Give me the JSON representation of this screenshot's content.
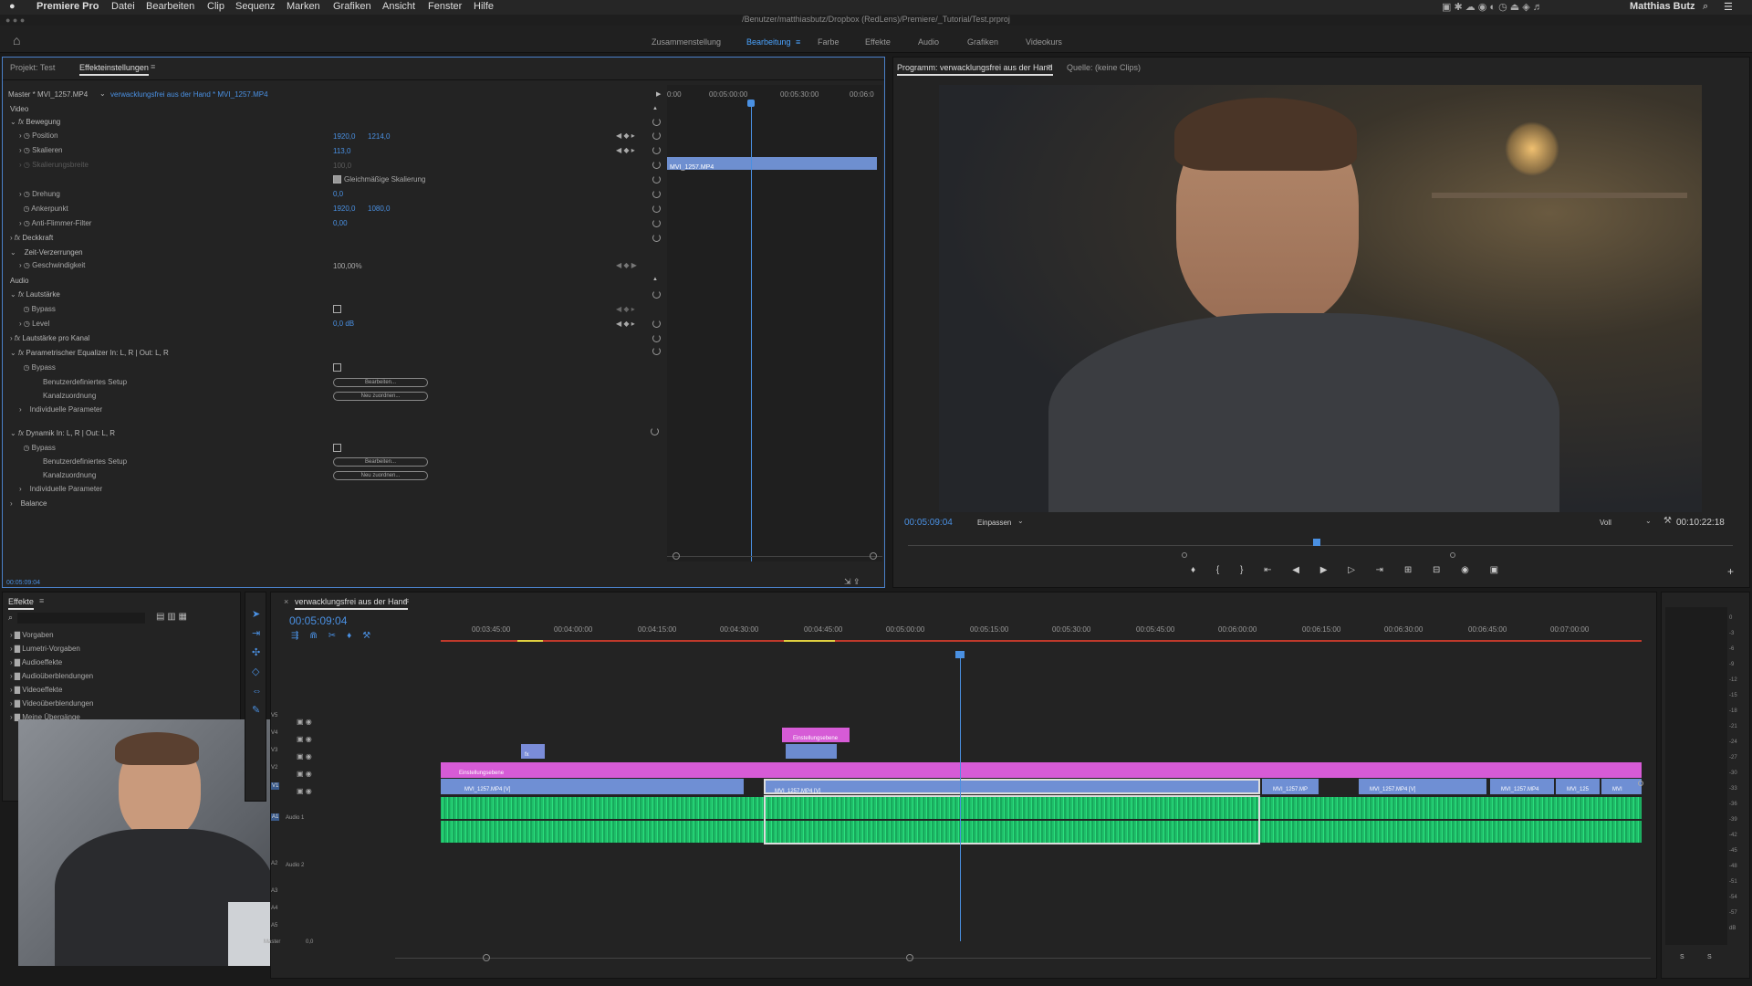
{
  "menubar": {
    "apple": "",
    "app": "Premiere Pro",
    "items": [
      "Datei",
      "Bearbeiten",
      "Clip",
      "Sequenz",
      "Marken",
      "Grafiken",
      "Ansicht",
      "Fenster",
      "Hilfe"
    ],
    "user": "Matthias Butz"
  },
  "title": "/Benutzer/matthiasbutz/Dropbox (RedLens)/Premiere/_Tutorial/Test.prproj",
  "workspaces": [
    "Zusammenstellung",
    "Bearbeitung",
    "Farbe",
    "Effekte",
    "Audio",
    "Grafiken",
    "Videokurs"
  ],
  "effect_controls": {
    "tab_project": "Projekt: Test",
    "tab_effects": "Effekteinstellungen",
    "master": "Master * MVI_1257.MP4",
    "sequence": "verwacklungsfrei aus der Hand * MVI_1257.MP4",
    "timecodes": [
      "0:00",
      "00:05:00:00",
      "00:05:30:00",
      "00:06:0"
    ],
    "clip": "MVI_1257.MP4",
    "video_label": "Video",
    "audio_label": "Audio",
    "bewegung": "Bewegung",
    "position_label": "Position",
    "position_x": "1920,0",
    "position_y": "1214,0",
    "skalieren_label": "Skalieren",
    "skalieren_val": "113,0",
    "skalbreite_label": "Skalierungsbreite",
    "skalbreite_val": "100,0",
    "uniform_label": "Gleichmäßige Skalierung",
    "drehung_label": "Drehung",
    "drehung_val": "0,0",
    "anker_label": "Ankerpunkt",
    "anker_x": "1920,0",
    "anker_y": "1080,0",
    "flimmer_label": "Anti-Flimmer-Filter",
    "flimmer_val": "0,00",
    "deckkraft": "Deckkraft",
    "zeitverz": "Zeit-Verzerrungen",
    "geschw_label": "Geschwindigkeit",
    "geschw_val": "100,00%",
    "lautstaerke": "Lautstärke",
    "bypass": "Bypass",
    "level_label": "Level",
    "level_val": "0,0 dB",
    "lautkanal": "Lautstärke pro Kanal",
    "eq": "Parametrischer Equalizer In: L, R | Out: L, R",
    "setup_label": "Benutzerdefiniertes Setup",
    "kanal_label": "Kanalzuordnung",
    "indiv_label": "Individuelle Parameter",
    "btn_edit": "Bearbeiten...",
    "btn_reassign": "Neu zuordnen...",
    "dynamik": "Dynamik In: L, R | Out: L, R",
    "balance": "Balance",
    "bottom_tc": "00:05:09:04"
  },
  "program": {
    "tab_program": "Programm: verwacklungsfrei aus der Hand",
    "tab_source": "Quelle: (keine Clips)",
    "timecode": "00:05:09:04",
    "fit": "Einpassen",
    "quality": "Voll",
    "duration": "00:10:22:18"
  },
  "effects_panel": {
    "title": "Effekte",
    "items": [
      "Vorgaben",
      "Lumetri-Vorgaben",
      "Audioeffekte",
      "Audioüberblendungen",
      "Videoeffekte",
      "Videoüberblendungen",
      "Meine Übergänge"
    ]
  },
  "timeline": {
    "title": "verwacklungsfrei aus der Hand",
    "timecode": "00:05:09:04",
    "ruler": [
      "00:03:45:00",
      "00:04:00:00",
      "00:04:15:00",
      "00:04:30:00",
      "00:04:45:00",
      "00:05:00:00",
      "00:05:15:00",
      "00:05:30:00",
      "00:05:45:00",
      "00:06:00:00",
      "00:06:15:00",
      "00:06:30:00",
      "00:06:45:00",
      "00:07:00:00"
    ],
    "tracks": [
      "V5",
      "V4",
      "V3",
      "V2",
      "V1",
      "A1",
      "A2",
      "A3",
      "A4",
      "A5"
    ],
    "audio1": "Audio 1",
    "audio2": "Audio 2",
    "master": "Master",
    "master_val": "0,0",
    "adj_layer": "Einstellungsebene",
    "clips": [
      "MVI_1257.MP4 [V]",
      "MVI_1257.MP4 [V]",
      "MVI_1257.MP",
      "MVI_1257.MP4 [V]",
      "MVI_1257.MP4",
      "MVI_125",
      "MVI"
    ],
    "fx_small": "fx"
  },
  "meter_scale": [
    "0",
    "-3",
    "-6",
    "-9",
    "-12",
    "-15",
    "-18",
    "-21",
    "-24",
    "-27",
    "-30",
    "-33",
    "-36",
    "-39",
    "-42",
    "-45",
    "-48",
    "-51",
    "-54",
    "-57",
    "dB"
  ],
  "meter_solo": [
    "S",
    "S"
  ]
}
